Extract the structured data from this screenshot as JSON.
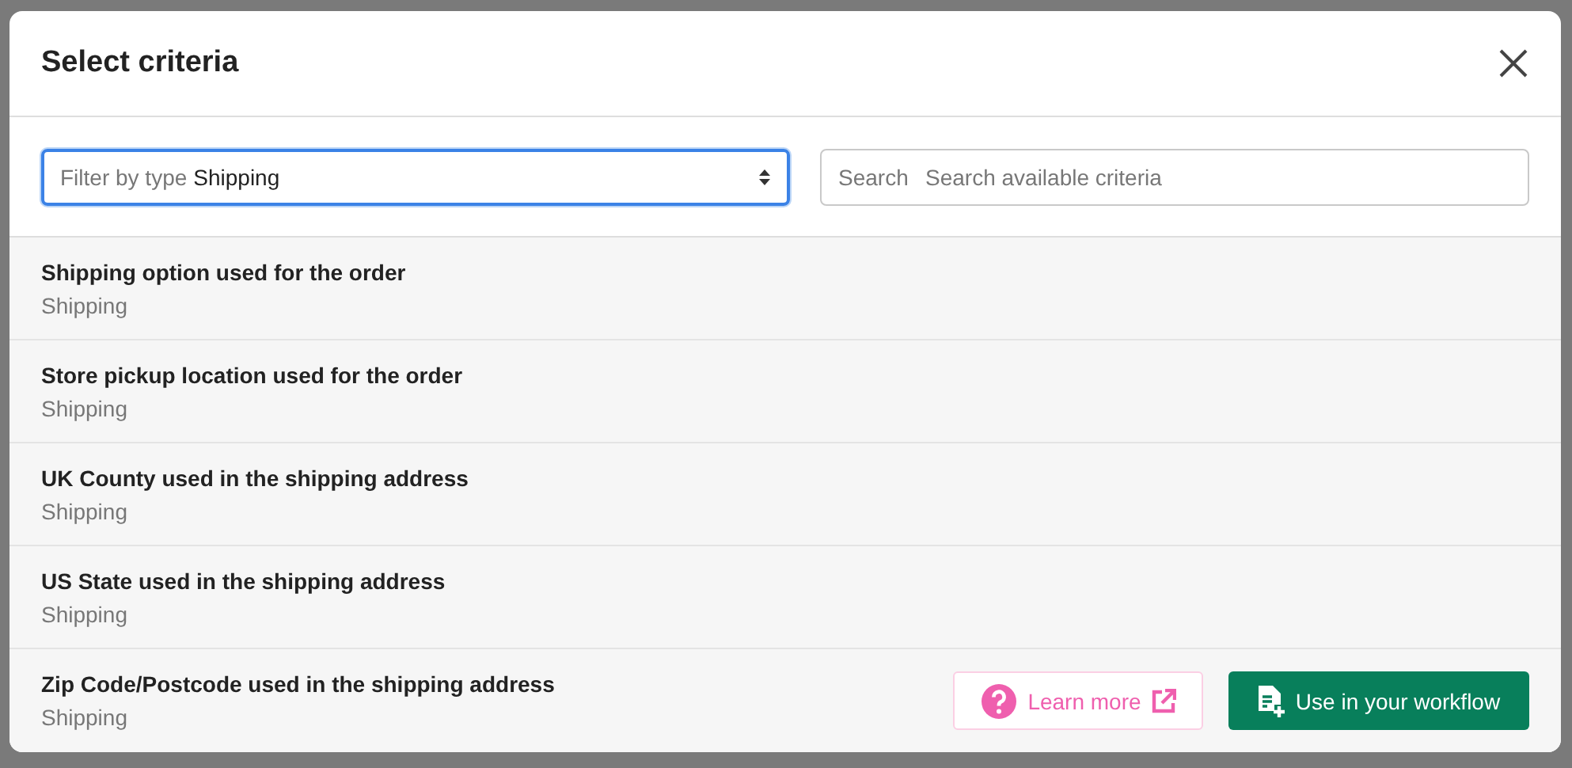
{
  "dialog": {
    "title": "Select criteria"
  },
  "filter": {
    "label": "Filter by type",
    "value": "Shipping",
    "focused": true
  },
  "search": {
    "label": "Search",
    "placeholder": "Search available criteria"
  },
  "criteria": [
    {
      "name": "Shipping option used for the order",
      "type": "Shipping",
      "selected": false
    },
    {
      "name": "Store pickup location used for the order",
      "type": "Shipping",
      "selected": false
    },
    {
      "name": "UK County used in the shipping address",
      "type": "Shipping",
      "selected": false
    },
    {
      "name": "US State used in the shipping address",
      "type": "Shipping",
      "selected": false
    },
    {
      "name": "Zip Code/Postcode used in the shipping address",
      "type": "Shipping",
      "selected": true
    }
  ],
  "row_actions": {
    "learn_more": "Learn more",
    "use": "Use in your workflow"
  }
}
